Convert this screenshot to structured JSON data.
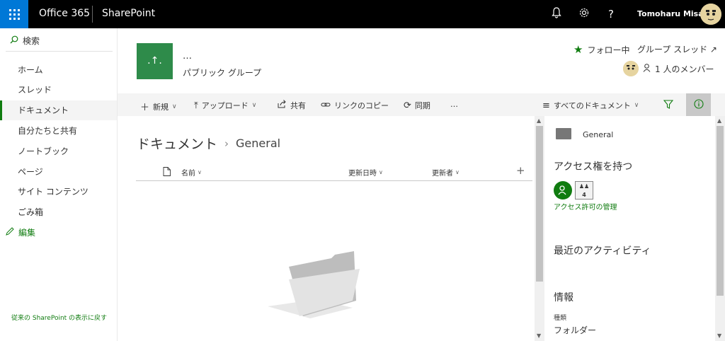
{
  "suite": {
    "brand": "Office 365",
    "app": "SharePoint",
    "user_name": "Tomoharu Misawa",
    "icons": [
      "bell-icon",
      "gear-icon",
      "help-icon"
    ]
  },
  "nav": {
    "search_label": "検索",
    "items": [
      {
        "label": "ホーム"
      },
      {
        "label": "スレッド"
      },
      {
        "label": "ドキュメント",
        "selected": true
      },
      {
        "label": "自分たちと共有"
      },
      {
        "label": "ノートブック"
      },
      {
        "label": "ページ"
      },
      {
        "label": "サイト コンテンツ"
      },
      {
        "label": "ごみ箱"
      }
    ],
    "edit_label": "編集",
    "classic_link": "従来の SharePoint の表示に戻す"
  },
  "group": {
    "logo_text": ".↑.",
    "name": "…",
    "type": "パブリック グループ",
    "follow_label": "フォロー中",
    "conversations_label": "グループ スレッド ↗",
    "members_label": "1 人のメンバー"
  },
  "commands": {
    "new": "新規",
    "upload": "アップロード",
    "share": "共有",
    "copy_link": "リンクのコピー",
    "sync": "同期",
    "more": "…",
    "view": "すべてのドキュメント"
  },
  "breadcrumb": {
    "root": "ドキュメント",
    "current": "General"
  },
  "columns": {
    "name": "名前",
    "modified": "更新日時",
    "modified_by": "更新者"
  },
  "panel": {
    "folder_name": "General",
    "access_heading": "アクセス権を持つ",
    "access_count": "4",
    "manage_access": "アクセス許可の管理",
    "recent_heading": "最近のアクティビティ",
    "info_heading": "情報",
    "type_label": "種類",
    "type_value": "フォルダー"
  },
  "colors": {
    "suite_bar": "#000000",
    "waffle": "#0078d7",
    "accent_green": "#107c10"
  }
}
